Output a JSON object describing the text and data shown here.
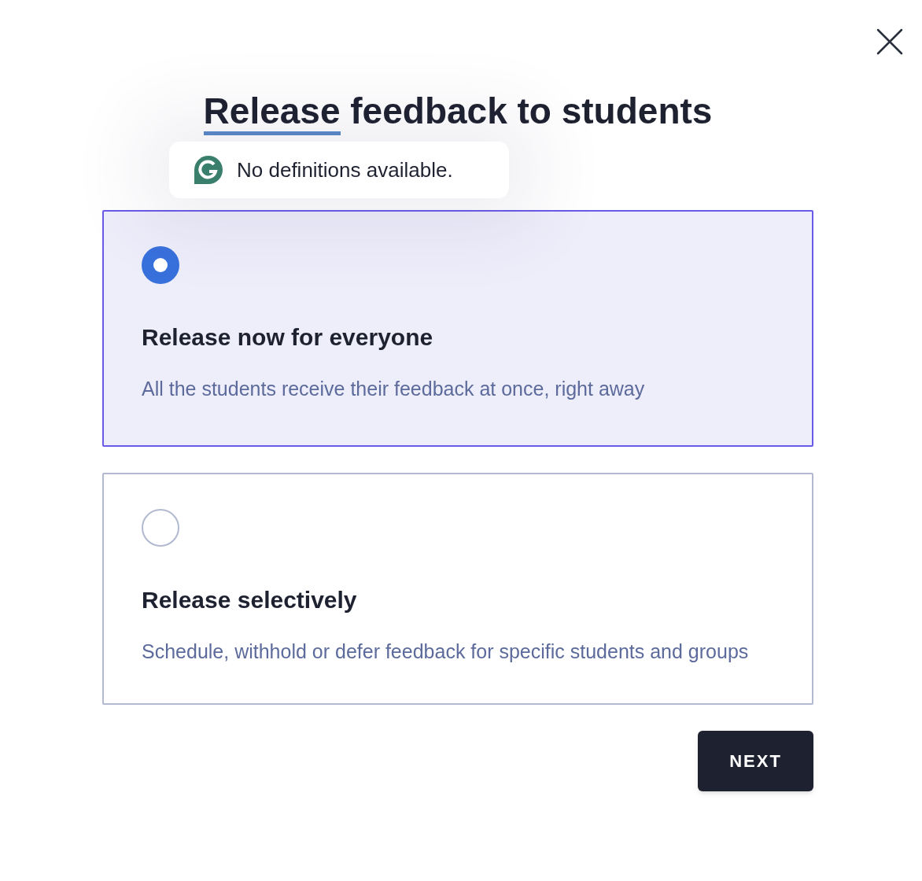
{
  "dialog": {
    "title": {
      "highlighted": "Release",
      "rest": " feedback to students"
    }
  },
  "tooltip": {
    "text": "No definitions available."
  },
  "options": [
    {
      "title": "Release now for everyone",
      "description": "All the students receive their feedback at once, right away",
      "selected": true
    },
    {
      "title": "Release selectively",
      "description": "Schedule, withhold or defer feedback for specific students and groups",
      "selected": false
    }
  ],
  "buttons": [
    {
      "label": "NEXT"
    }
  ]
}
